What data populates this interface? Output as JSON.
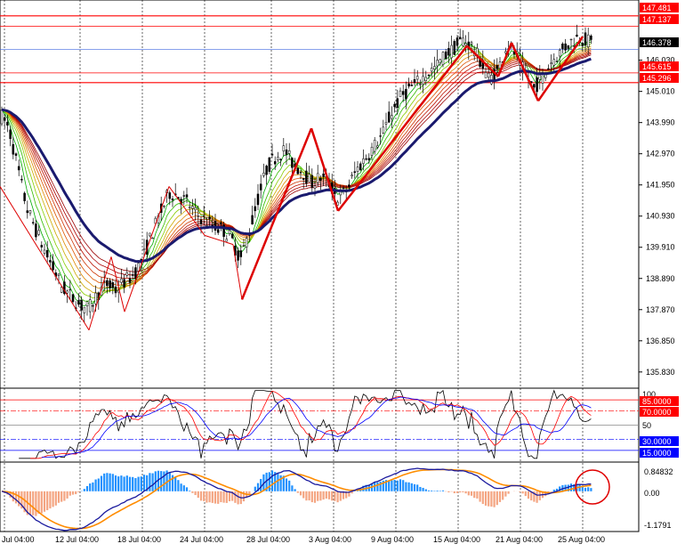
{
  "colors": {
    "bg": "#ffffff",
    "grid": "#000000",
    "bull_candle": "#000000",
    "bear_candle": "#000000",
    "ma_slow": "#1a1a6e",
    "hline": "#ff0000",
    "current_line": "#4169e1",
    "current_tag": "#000000",
    "rsi_black": "#000000",
    "rsi_red": "#ff0000",
    "rsi_blue": "#0000ff",
    "hist_pos": "#1e90ff",
    "hist_neg": "#f4a582",
    "macd_main": "#1a1a9e",
    "macd_signal": "#ff8c00",
    "circle": "#e00000"
  },
  "price_labels": {
    "h1": "147.481",
    "h2": "147.137",
    "current": "146.378",
    "h3": "145.615",
    "h4": "145.296"
  },
  "osc_labels": {
    "top": "100",
    "l85": "85.0000",
    "l70": "70.0000",
    "l50": "50",
    "l30": "30.0000",
    "l15": "15.0000",
    "macd_top": "0.84832",
    "macd_zero": "0.00",
    "macd_bottom": "-1.1791"
  },
  "chart_data": {
    "type": "candlestick",
    "price_axis": {
      "ylim": [
        135.3,
        148.0
      ],
      "ticks": [
        "146.030",
        "145.010",
        "143.990",
        "142.970",
        "141.950",
        "140.930",
        "139.910",
        "138.890",
        "137.870",
        "136.850",
        "135.830"
      ]
    },
    "x_axis": {
      "ticks": [
        "Jul 04:00",
        "12 Jul 04:00",
        "18 Jul 04:00",
        "24 Jul 04:00",
        "28 Jul 04:00",
        "3 Aug 04:00",
        "9 Aug 04:00",
        "15 Aug 04:00",
        "21 Aug 04:00",
        "25 Aug 04:00"
      ]
    },
    "horizontal_levels": [
      147.481,
      147.137,
      145.615,
      145.296
    ],
    "current_price": 146.378,
    "price_path": [
      [
        0,
        144.3
      ],
      [
        10,
        143.8
      ],
      [
        20,
        142.5
      ],
      [
        30,
        141.2
      ],
      [
        40,
        140.5
      ],
      [
        50,
        139.8
      ],
      [
        60,
        139.2
      ],
      [
        70,
        138.6
      ],
      [
        80,
        138.3
      ],
      [
        90,
        138.0
      ],
      [
        100,
        137.9
      ],
      [
        110,
        138.4
      ],
      [
        120,
        138.7
      ],
      [
        130,
        138.5
      ],
      [
        140,
        138.8
      ],
      [
        150,
        139.0
      ],
      [
        160,
        139.5
      ],
      [
        170,
        140.3
      ],
      [
        180,
        141.0
      ],
      [
        190,
        141.7
      ],
      [
        200,
        141.6
      ],
      [
        210,
        141.4
      ],
      [
        220,
        141.0
      ],
      [
        230,
        140.8
      ],
      [
        240,
        140.6
      ],
      [
        250,
        140.5
      ],
      [
        260,
        140.2
      ],
      [
        270,
        139.5
      ],
      [
        280,
        140.4
      ],
      [
        290,
        141.5
      ],
      [
        300,
        142.5
      ],
      [
        310,
        142.9
      ],
      [
        320,
        143.1
      ],
      [
        330,
        142.6
      ],
      [
        340,
        142.4
      ],
      [
        350,
        142.0
      ],
      [
        360,
        142.2
      ],
      [
        370,
        142.0
      ],
      [
        380,
        141.5
      ],
      [
        390,
        141.8
      ],
      [
        400,
        142.4
      ],
      [
        410,
        142.8
      ],
      [
        420,
        143.2
      ],
      [
        430,
        143.6
      ],
      [
        440,
        144.3
      ],
      [
        450,
        144.8
      ],
      [
        460,
        145.1
      ],
      [
        470,
        145.3
      ],
      [
        480,
        145.6
      ],
      [
        490,
        145.8
      ],
      [
        500,
        146.2
      ],
      [
        510,
        146.4
      ],
      [
        520,
        146.7
      ],
      [
        530,
        146.5
      ],
      [
        540,
        146.0
      ],
      [
        550,
        145.4
      ],
      [
        560,
        145.7
      ],
      [
        570,
        146.6
      ],
      [
        580,
        146.2
      ],
      [
        590,
        145.6
      ],
      [
        600,
        145.1
      ],
      [
        610,
        145.5
      ],
      [
        620,
        146.0
      ],
      [
        630,
        146.3
      ],
      [
        640,
        146.6
      ],
      [
        650,
        146.8
      ],
      [
        665,
        146.6
      ]
    ],
    "zigzag_points": [
      [
        0,
        141.9
      ],
      [
        100,
        137.2
      ],
      [
        125,
        139.6
      ],
      [
        140,
        137.8
      ],
      [
        190,
        141.9
      ],
      [
        230,
        140.3
      ],
      [
        262,
        140.0
      ],
      [
        272,
        138.2
      ],
      [
        350,
        143.8
      ],
      [
        380,
        141.1
      ],
      [
        525,
        146.5
      ],
      [
        560,
        145.5
      ],
      [
        575,
        146.6
      ],
      [
        605,
        144.7
      ],
      [
        655,
        146.8
      ]
    ],
    "rsi": {
      "ylim": [
        0,
        100
      ],
      "levels": [
        85,
        70,
        50,
        30,
        15
      ]
    },
    "macd": {
      "ylim": [
        -1.1791,
        0.84832
      ]
    }
  }
}
